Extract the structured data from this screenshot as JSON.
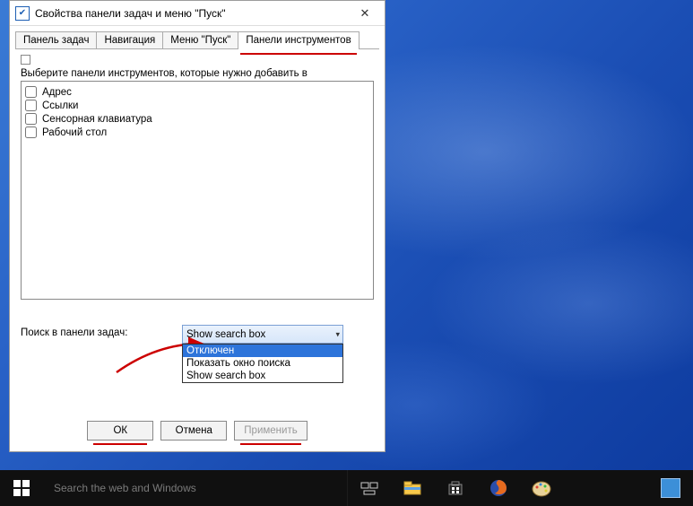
{
  "window": {
    "title": "Свойства панели задач и меню \"Пуск\"",
    "close_glyph": "✕"
  },
  "tabs": [
    {
      "label": "Панель задач",
      "active": false,
      "underline": false
    },
    {
      "label": "Навигация",
      "active": false,
      "underline": false
    },
    {
      "label": "Меню \"Пуск\"",
      "active": false,
      "underline": false
    },
    {
      "label": "Панели инструментов",
      "active": true,
      "underline": true
    }
  ],
  "instruction": "Выберите панели инструментов, которые нужно добавить в",
  "toolbars": [
    {
      "label": "Адрес",
      "checked": false
    },
    {
      "label": "Ссылки",
      "checked": false
    },
    {
      "label": "Сенсорная клавиатура",
      "checked": false
    },
    {
      "label": "Рабочий стол",
      "checked": false
    }
  ],
  "search": {
    "label": "Поиск в панели задач:",
    "selected": "Show search box",
    "options": [
      "Отключен",
      "Показать окно поиска",
      "Show search box"
    ],
    "highlighted_index": 0
  },
  "buttons": {
    "ok": "ОК",
    "cancel": "Отмена",
    "apply": "Применить"
  },
  "taskbar": {
    "search_placeholder": "Search the web and Windows"
  }
}
